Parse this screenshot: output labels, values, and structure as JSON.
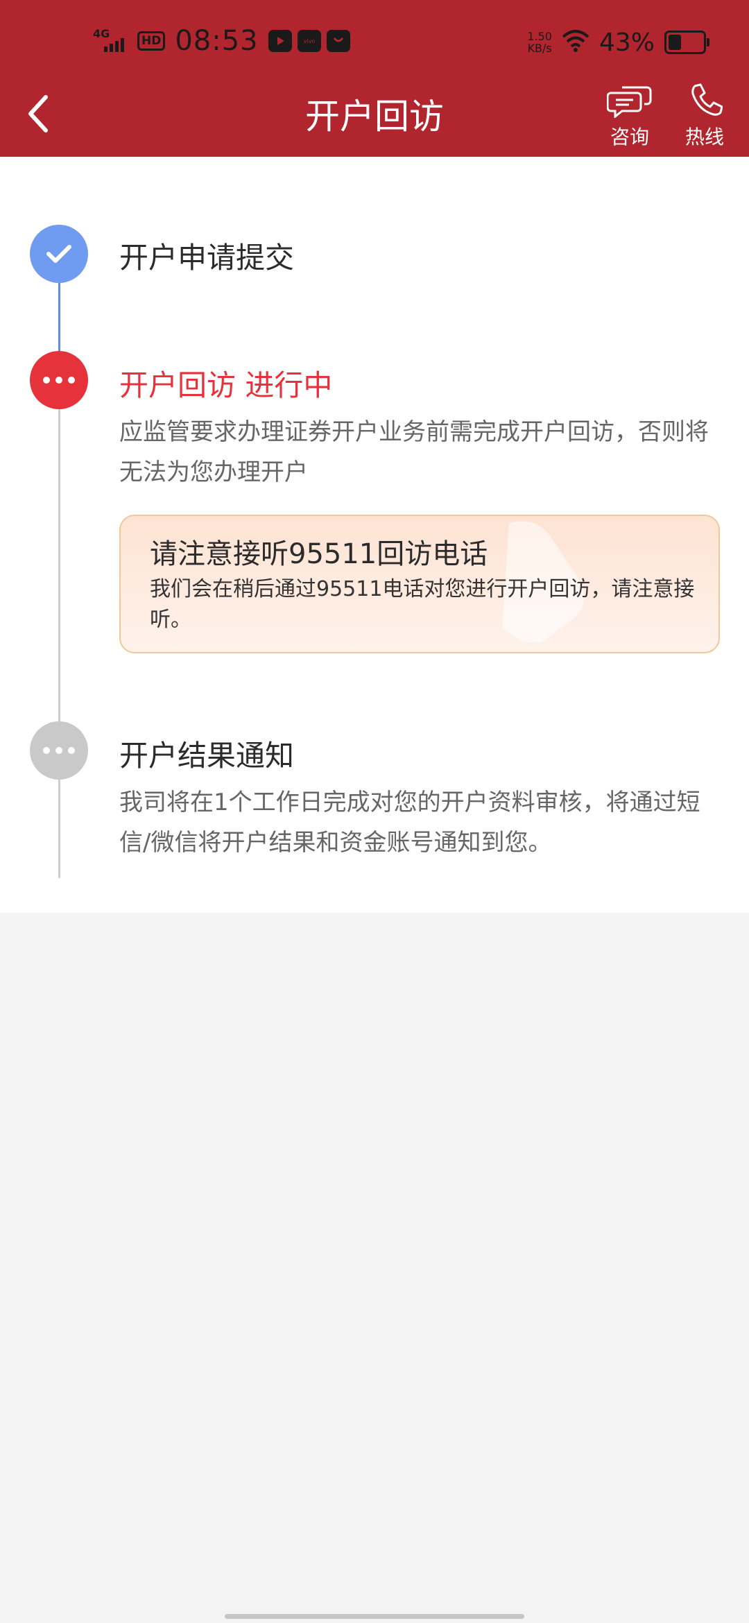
{
  "status_bar": {
    "network": "4G",
    "hd": "HD",
    "time": "08:53",
    "speed_value": "1.50",
    "speed_unit": "KB/s",
    "battery": "43%",
    "battery_level": 0.43
  },
  "header": {
    "title": "开户回访",
    "consult_label": "咨询",
    "hotline_label": "热线",
    "bg_color": "#b1262e"
  },
  "steps": [
    {
      "title": "开户申请提交",
      "status": "done",
      "color": "#6f9bf0"
    },
    {
      "title": "开户回访 进行中",
      "status": "in-progress",
      "color": "#e5323b",
      "desc": "应监管要求办理证券开户业务前需完成开户回访，否则将无法为您办理开户",
      "card": {
        "title": "请注意接听95511回访电话",
        "desc": "我们会在稍后通过95511电话对您进行开户回访，请注意接听。"
      }
    },
    {
      "title": "开户结果通知",
      "status": "pending",
      "color": "#c9c9c9",
      "desc": "我司将在1个工作日完成对您的开户资料审核，将通过短信/微信将开户结果和资金账号通知到您。"
    }
  ]
}
